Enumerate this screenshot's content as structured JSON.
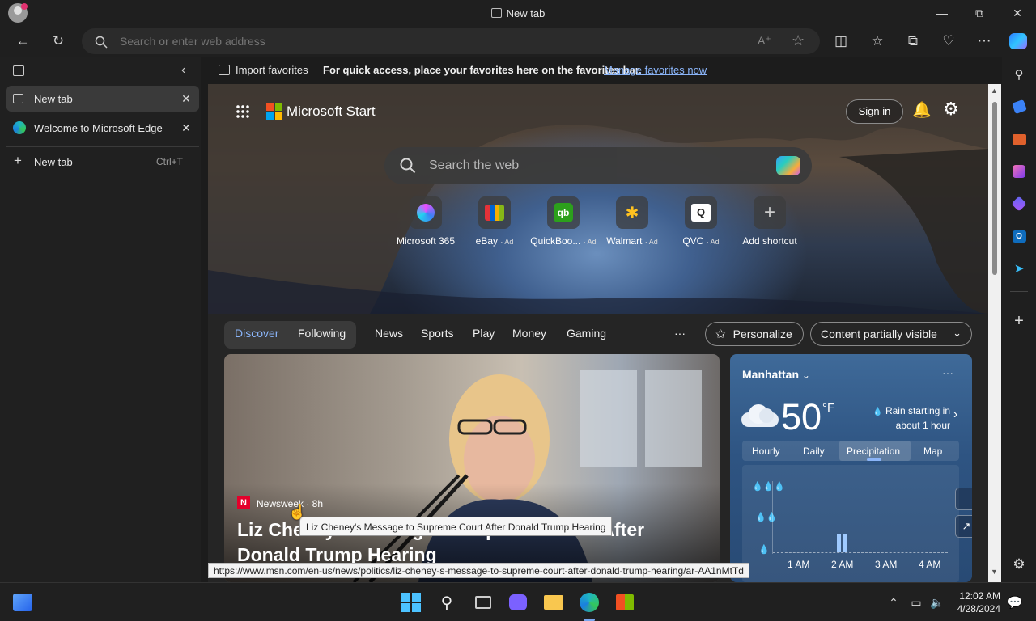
{
  "window": {
    "title": "New tab"
  },
  "toolbar": {
    "address_placeholder": "Search or enter web address"
  },
  "favorites_bar": {
    "import_label": "Import favorites",
    "message": "For quick access, place your favorites here on the favorites bar.",
    "manage_link": "Manage favorites now"
  },
  "vertical_tabs": {
    "tabs": [
      {
        "label": "New tab"
      },
      {
        "label": "Welcome to Microsoft Edge"
      }
    ],
    "new_tab": {
      "label": "New tab",
      "shortcut": "Ctrl+T"
    }
  },
  "start_page": {
    "brand": "Microsoft Start",
    "sign_in": "Sign in",
    "search_placeholder": "Search the web",
    "shortcuts": [
      {
        "label": "Microsoft 365",
        "ad": ""
      },
      {
        "label": "eBay",
        "ad": "· Ad"
      },
      {
        "label": "QuickBoo...",
        "ad": "· Ad"
      },
      {
        "label": "Walmart",
        "ad": "· Ad"
      },
      {
        "label": "QVC",
        "ad": "· Ad"
      },
      {
        "label": "Add shortcut",
        "ad": ""
      }
    ],
    "nav": {
      "items": [
        "Discover",
        "Following",
        "News",
        "Sports",
        "Play",
        "Money",
        "Gaming"
      ],
      "more": "···",
      "personalize": "Personalize",
      "content": "Content partially visible"
    },
    "article": {
      "source": "Newsweek · 8h",
      "headline": "Liz Cheney's Message to Supreme Court After Donald Trump Hearing"
    },
    "weather": {
      "location": "Manhattan",
      "temp": "50",
      "unit": "°F",
      "alert_line1": "Rain starting in",
      "alert_line2": "about 1 hour",
      "tabs": [
        "Hourly",
        "Daily",
        "Precipitation",
        "Map"
      ],
      "times": [
        "1 AM",
        "2 AM",
        "3 AM",
        "4 AM"
      ],
      "menu": "···"
    }
  },
  "tooltip": "Liz Cheney's Message to Supreme Court After Donald Trump Hearing",
  "status_url": "https://www.msn.com/en-us/news/politics/liz-cheney-s-message-to-supreme-court-after-donald-trump-hearing/ar-AA1nMtTd",
  "taskbar": {
    "time": "12:02 AM",
    "date": "4/28/2024"
  },
  "colors": {
    "accent": "#7aa7f0",
    "link": "#8ab4f8",
    "titlebar": "#1f1f1f"
  }
}
